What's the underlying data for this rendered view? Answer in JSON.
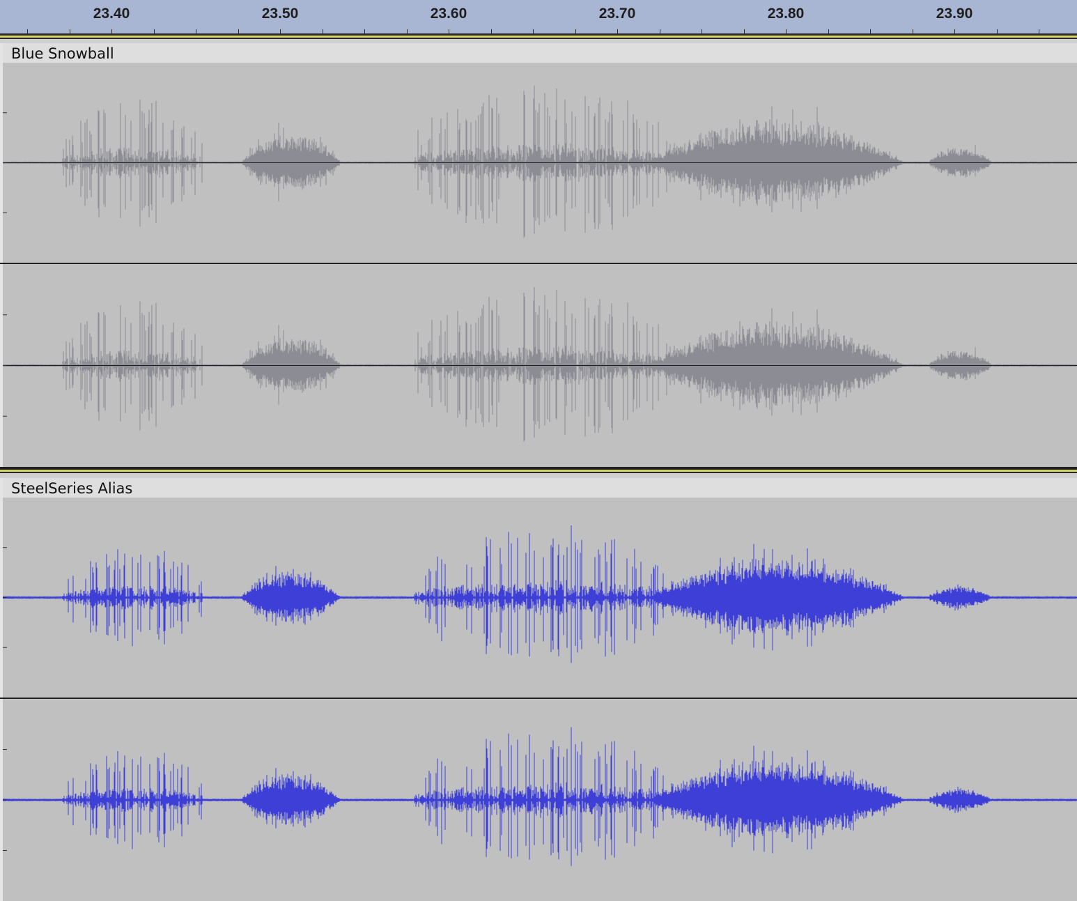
{
  "ruler": {
    "labels": [
      "23.40",
      "23.50",
      "23.60",
      "23.70",
      "23.80",
      "23.90"
    ]
  },
  "tracks": [
    {
      "name": "Blue Snowball",
      "waveform_color": "#8c8c94",
      "channels": [
        "left",
        "right"
      ]
    },
    {
      "name": "SteelSeries Alias",
      "waveform_color": "#3d3fd6",
      "channels": [
        "left",
        "right"
      ]
    }
  ],
  "colors": {
    "background": "#c0c0c0",
    "ruler": "#a9b6d3",
    "separator_yellow": "#d8d36a"
  }
}
